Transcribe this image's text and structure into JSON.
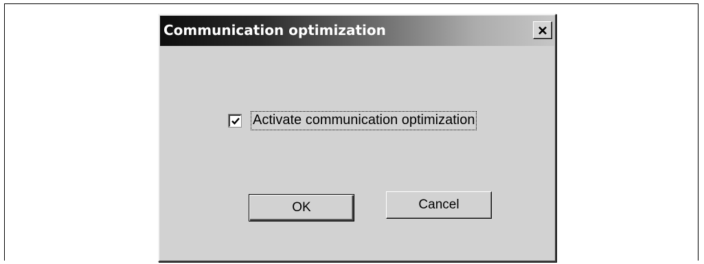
{
  "dialog": {
    "title": "Communication optimization",
    "close_icon": "close-x-icon"
  },
  "option": {
    "label": "Activate communication optimization",
    "checked": true,
    "check_icon": "checkmark-icon"
  },
  "buttons": {
    "ok_label": "OK",
    "cancel_label": "Cancel"
  },
  "colors": {
    "dialog_face": "#d2d2d2",
    "title_gradient_start": "#0e0e0e",
    "title_gradient_end": "#c6c6c6",
    "title_text": "#ffffff"
  }
}
